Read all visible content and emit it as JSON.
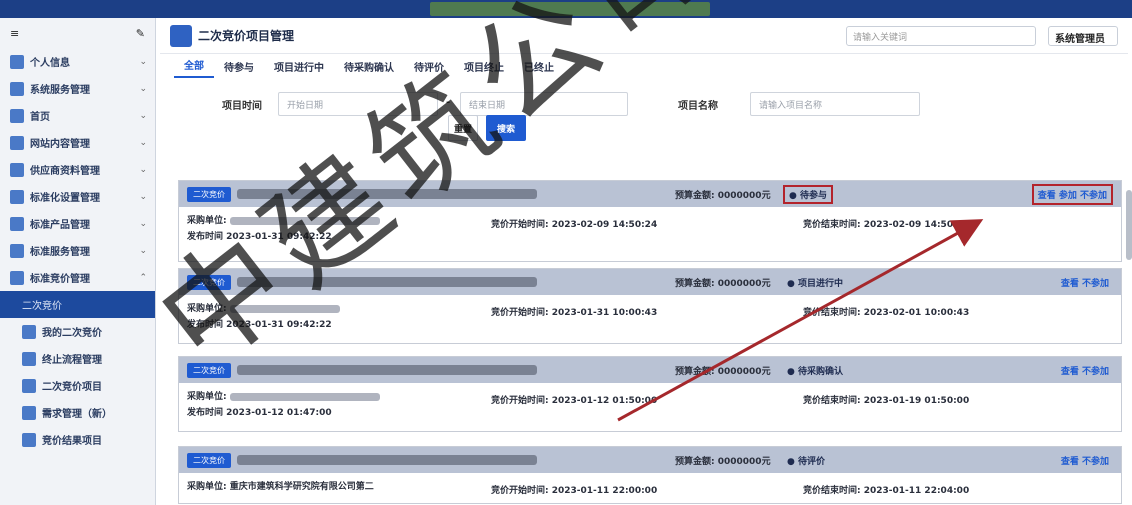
{
  "page": {
    "title": "二次竞价项目管理"
  },
  "header": {
    "search_placeholder": "请输入关键词",
    "user_label": "系统管理员"
  },
  "sidebar": {
    "items": [
      {
        "label": "个人信息"
      },
      {
        "label": "系统服务管理"
      },
      {
        "label": "首页"
      },
      {
        "label": "网站内容管理"
      },
      {
        "label": "供应商资料管理"
      },
      {
        "label": "标准化设置管理"
      },
      {
        "label": "标准产品管理"
      },
      {
        "label": "标准服务管理"
      },
      {
        "label": "标准竞价管理"
      },
      {
        "label": "二次竞价"
      },
      {
        "label": "我的二次竞价"
      },
      {
        "label": "终止流程管理"
      },
      {
        "label": "二次竞价项目"
      },
      {
        "label": "需求管理（新）"
      },
      {
        "label": "竞价结果项目"
      }
    ]
  },
  "tabs": [
    {
      "label": "全部"
    },
    {
      "label": "待参与"
    },
    {
      "label": "项目进行中"
    },
    {
      "label": "待采购确认"
    },
    {
      "label": "待评价"
    },
    {
      "label": "项目终止"
    },
    {
      "label": "已终止"
    }
  ],
  "filters": {
    "date_label": "项目时间",
    "date_start_placeholder": "开始日期",
    "date_sep": "-",
    "date_end_placeholder": "结束日期",
    "name_label": "项目名称",
    "name_placeholder": "请输入项目名称"
  },
  "buttons": {
    "reset": "重置",
    "search": "搜索"
  },
  "cards": [
    {
      "tag": "二次竞价",
      "amount": "预算金额: 0000000元",
      "status": "● 待参与",
      "ops": "查看  参加  不参加",
      "unit": "采购单位:",
      "time_label": "发布时间",
      "time": "2023-01-31 09:42:22",
      "start": "竞价开始时间: 2023-02-09 14:50:24",
      "end": "竞价结束时间: 2023-02-09 14:50:24"
    },
    {
      "tag": "二次竞价",
      "amount": "预算金额: 0000000元",
      "status": "● 项目进行中",
      "ops": "查看  不参加",
      "unit": "采购单位:",
      "time_label": "发布时间",
      "time": "2023-01-31 09:42:22",
      "start": "竞价开始时间: 2023-01-31 10:00:43",
      "end": "竞价结束时间: 2023-02-01 10:00:43"
    },
    {
      "tag": "二次竞价",
      "amount": "预算金额: 0000000元",
      "status": "● 待采购确认",
      "ops": "查看  不参加",
      "unit": "采购单位:",
      "time_label": "发布时间",
      "time": "2023-01-12 01:47:00",
      "start": "竞价开始时间: 2023-01-12 01:50:00",
      "end": "竞价结束时间: 2023-01-19 01:50:00"
    },
    {
      "tag": "二次竞价",
      "amount": "预算金额: 0000000元",
      "status": "● 待评价",
      "ops": "查看  不参加",
      "unit": "采购单位: 重庆市建筑科学研究院有限公司第二",
      "time_label": "发布时间",
      "time": "2023-01-11 22:00:00",
      "start": "竞价开始时间: 2023-01-11 22:00:00",
      "end": "竞价结束时间: 2023-01-11 22:04:00"
    }
  ],
  "watermark": {
    "text": "中建筑公司"
  },
  "colors": {
    "primary": "#1f5bd1",
    "sidebar_active": "#1d4a9e",
    "topbar": "#1c3f86",
    "highlight": "#b3232b"
  }
}
